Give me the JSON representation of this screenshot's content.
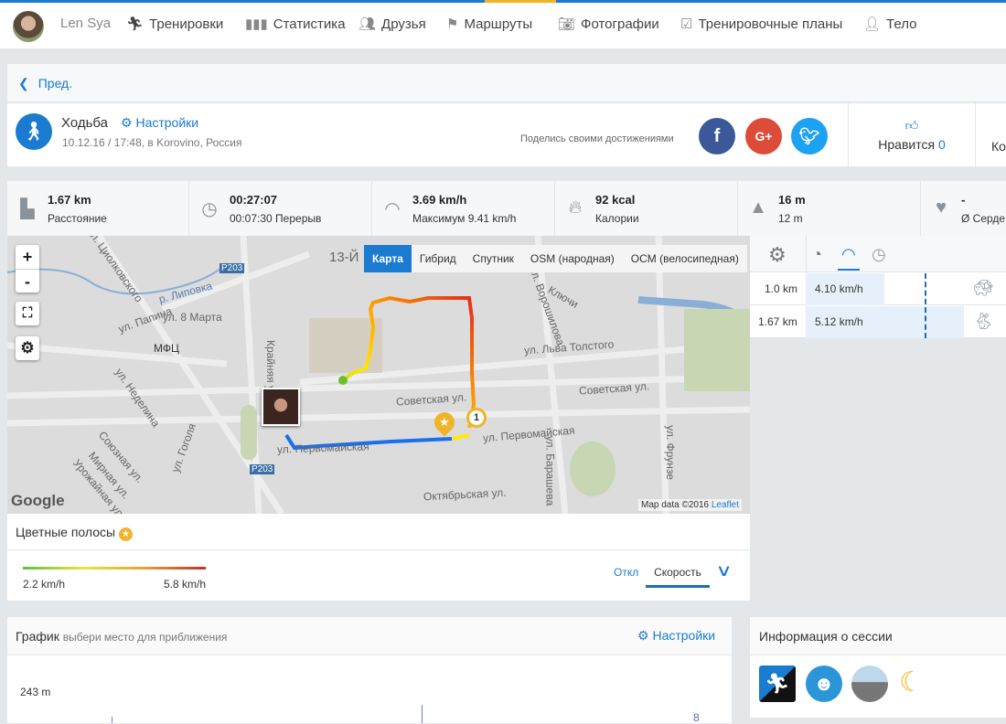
{
  "nav": {
    "user": "Len Sya",
    "items": [
      "Тренировки",
      "Статистика",
      "Друзья",
      "Маршруты",
      "Фотографии",
      "Тренировочные планы",
      "Тело"
    ]
  },
  "prev": "Пред.",
  "header": {
    "activity": "Ходьба",
    "settings": "Настройки",
    "meta": "10.12.16 / 17:48, в Korovino, Россия",
    "share": "Поделись своими достижениями",
    "like_label": "Нравится",
    "like_count": "0",
    "comments_partial": "Ко"
  },
  "stats": [
    {
      "value": "1.67 km",
      "label": "Расстояние",
      "icon": "road-icon"
    },
    {
      "value": "00:27:07",
      "label": "00:07:30 Перерыв",
      "icon": "stopwatch-icon"
    },
    {
      "value": "3.69 km/h",
      "label": "Максимум 9.41 km/h",
      "icon": "speedometer-icon"
    },
    {
      "value": "92 kcal",
      "label": "Калории",
      "icon": "flame-icon"
    },
    {
      "value": "16 m",
      "label": "12 m",
      "icon": "elevation-icon"
    },
    {
      "value": "-",
      "label": "Ø Серде",
      "icon": "heart-icon"
    }
  ],
  "map": {
    "tabs": [
      "Карта",
      "Гибрид",
      "Спутник",
      "OSM (народная)",
      "OCM (велосипедная)"
    ],
    "active_tab": "Карта",
    "zoom_in": "+",
    "zoom_out": "-",
    "labels": [
      "13-Й",
      "ул. Циолковского",
      "р. Липовка",
      "P203",
      "ул. Папина",
      "ул. 8 Марта",
      "МФЦ",
      "Крайняя ул.",
      "ул. Неделина",
      "Советская ул.",
      "ул. Первомайская",
      "ул. Ворошилова",
      "ул. Льва Толстого",
      "Союзная ул.",
      "Мирная ул.",
      "Урожайная ул.",
      "ул. Гоголя",
      "Октябрьская ул.",
      "ул. Барашева",
      "ул. Фрунзе",
      "Ключи"
    ],
    "marker": "1",
    "attribution": "Map data ©2016",
    "leaflet": "Leaflet",
    "logo": "Google"
  },
  "splits": {
    "rows": [
      {
        "dist": "1.0 km",
        "speed": "4.10 km/h",
        "fill": 0.31,
        "icon": "turtle-icon"
      },
      {
        "dist": "1.67 km",
        "speed": "5.12 km/h",
        "fill": 0.77,
        "icon": "rabbit-icon"
      }
    ]
  },
  "colorbar": {
    "title": "Цветные полосы",
    "min": "2.2 km/h",
    "max": "5.8 km/h",
    "off": "Откл",
    "speed": "Скорость"
  },
  "graph": {
    "title": "График",
    "hint": "выбери место для приближения",
    "settings": "Настройки",
    "ymax": "243 m",
    "marker": "8"
  },
  "session": {
    "title": "Информация о сессии"
  }
}
